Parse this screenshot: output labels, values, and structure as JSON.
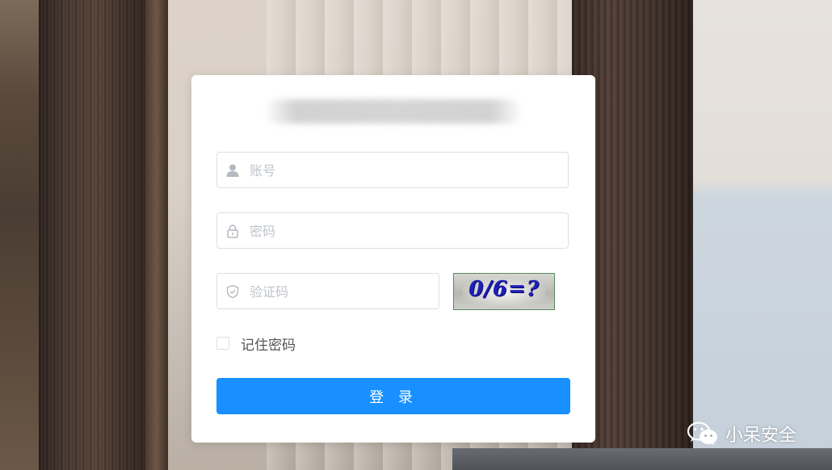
{
  "login": {
    "username_placeholder": "账号",
    "password_placeholder": "密码",
    "captcha_placeholder": "验证码",
    "captcha_text": "0/6=?",
    "remember_label": "记住密码",
    "login_button": "登 录"
  },
  "watermark": {
    "text": "小呆安全",
    "icon": "wechat-icon"
  },
  "colors": {
    "primary": "#1890ff",
    "border": "#dcdfe6",
    "placeholder": "#c0c4cc",
    "captcha_text": "#1f1fb8"
  }
}
